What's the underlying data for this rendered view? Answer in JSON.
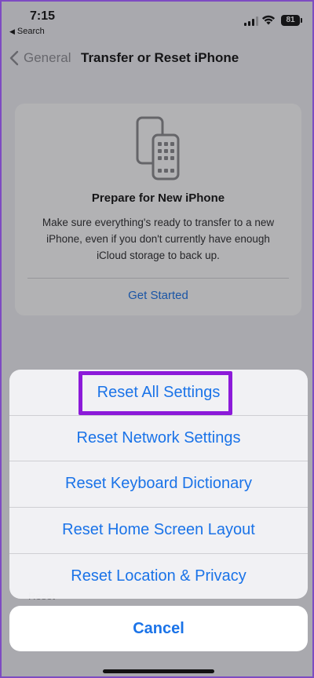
{
  "status_bar": {
    "time": "7:15",
    "back_app": "Search",
    "battery": "81",
    "icons": [
      "cellular-signal-icon",
      "wifi-icon",
      "battery-icon"
    ]
  },
  "nav": {
    "back_label": "General",
    "title": "Transfer or Reset iPhone"
  },
  "prepare_card": {
    "icon": "two-phones-icon",
    "title": "Prepare for New iPhone",
    "description": "Make sure everything's ready to transfer to a new iPhone, even if you don't currently have enough iCloud storage to back up.",
    "action": "Get Started"
  },
  "background_text": "Reset",
  "action_sheet": {
    "items": [
      {
        "label": "Reset All Settings",
        "highlighted": true
      },
      {
        "label": "Reset Network Settings"
      },
      {
        "label": "Reset Keyboard Dictionary"
      },
      {
        "label": "Reset Home Screen Layout"
      },
      {
        "label": "Reset Location & Privacy"
      }
    ],
    "cancel": "Cancel"
  },
  "colors": {
    "accent": "#1a73e8",
    "highlight_box": "#8c1ad9",
    "frame_border": "#7d4bc2"
  }
}
